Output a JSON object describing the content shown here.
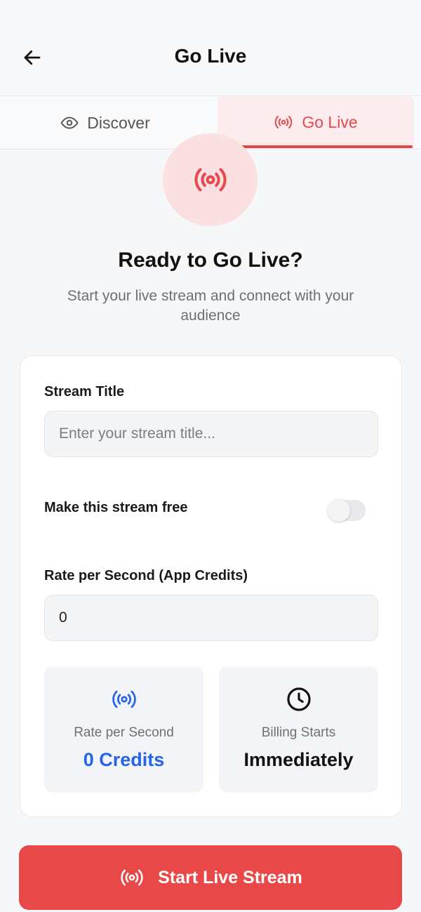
{
  "header": {
    "title": "Go Live",
    "back_icon": "arrow-left-icon"
  },
  "tabs": [
    {
      "label": "Discover",
      "icon": "eye-icon",
      "active": false
    },
    {
      "label": "Go Live",
      "icon": "broadcast-icon",
      "active": true
    }
  ],
  "hero": {
    "icon": "broadcast-icon",
    "title": "Ready to Go Live?",
    "subtitle": "Start your live stream and connect with your audience"
  },
  "form": {
    "stream_title_label": "Stream Title",
    "stream_title_placeholder": "Enter your stream title...",
    "stream_title_value": "",
    "free_label": "Make this stream free",
    "free_enabled": false,
    "rate_label": "Rate per Second (App Credits)",
    "rate_value": "0"
  },
  "info": {
    "rate": {
      "icon": "broadcast-icon",
      "caption": "Rate per Second",
      "value": "0 Credits"
    },
    "billing": {
      "icon": "clock-icon",
      "caption": "Billing Starts",
      "value": "Immediately"
    }
  },
  "cta": {
    "label": "Start Live Stream",
    "icon": "broadcast-icon"
  },
  "colors": {
    "accent_red": "#e84848",
    "accent_blue": "#2563eb",
    "tab_active_bg": "#fdeced",
    "hero_circle_bg": "#fae0e0"
  }
}
